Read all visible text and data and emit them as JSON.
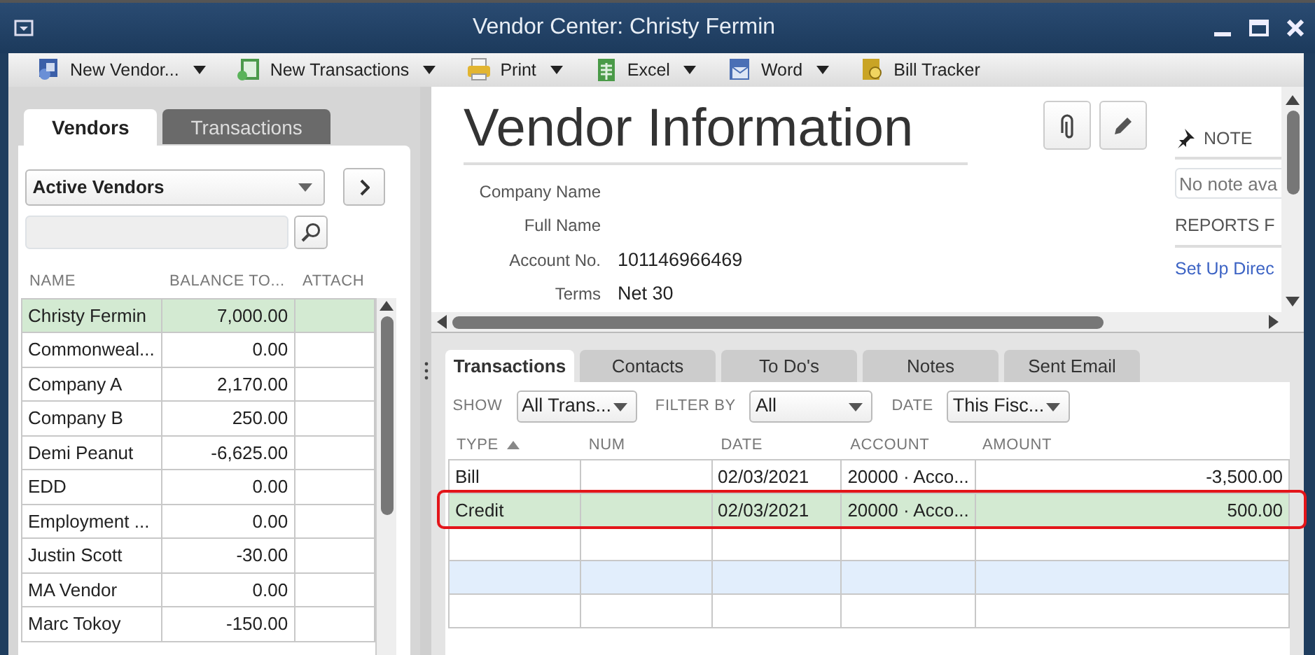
{
  "window": {
    "title": "Vendor Center: Christy Fermin"
  },
  "toolbar": [
    {
      "label": "New Vendor...",
      "dropdown": true
    },
    {
      "label": "New Transactions",
      "dropdown": true
    },
    {
      "label": "Print",
      "dropdown": true
    },
    {
      "label": "Excel",
      "dropdown": true
    },
    {
      "label": "Word",
      "dropdown": true
    },
    {
      "label": "Bill Tracker",
      "dropdown": false
    }
  ],
  "left_panel": {
    "tabs": [
      {
        "label": "Vendors",
        "selected": true
      },
      {
        "label": "Transactions",
        "selected": false
      }
    ],
    "view_filter": "Active Vendors",
    "columns": [
      "NAME",
      "BALANCE TO...",
      "ATTACH"
    ],
    "rows": [
      {
        "name": "Christy Fermin",
        "balance": "7,000.00",
        "selected": true
      },
      {
        "name": "Commonweal...",
        "balance": "0.00",
        "selected": false
      },
      {
        "name": "Company A",
        "balance": "2,170.00",
        "selected": false
      },
      {
        "name": "Company B",
        "balance": "250.00",
        "selected": false
      },
      {
        "name": "Demi Peanut",
        "balance": "-6,625.00",
        "selected": false
      },
      {
        "name": "EDD",
        "balance": "0.00",
        "selected": false
      },
      {
        "name": "Employment ...",
        "balance": "0.00",
        "selected": false
      },
      {
        "name": "Justin Scott",
        "balance": "-30.00",
        "selected": false
      },
      {
        "name": "MA Vendor",
        "balance": "0.00",
        "selected": false
      },
      {
        "name": "Marc Tokoy",
        "balance": "-150.00",
        "selected": false
      }
    ]
  },
  "vendor_info": {
    "title": "Vendor Information",
    "fields": [
      {
        "label": "Company Name"
      },
      {
        "label": "Full Name"
      },
      {
        "label": "Account No.",
        "value": "101146966469"
      },
      {
        "label": "Terms",
        "value": "Net 30"
      }
    ],
    "note_heading": "NOTE",
    "note_placeholder": "No note ava",
    "reports_heading": "REPORTS F",
    "reports_link": "Set Up Direc"
  },
  "transactions": {
    "tabs": [
      {
        "label": "Transactions",
        "selected": true
      },
      {
        "label": "Contacts",
        "selected": false
      },
      {
        "label": "To Do's",
        "selected": false
      },
      {
        "label": "Notes",
        "selected": false
      },
      {
        "label": "Sent Email",
        "selected": false
      }
    ],
    "filters": [
      {
        "label": "SHOW",
        "value": "All Trans..."
      },
      {
        "label": "FILTER BY",
        "value": "All"
      },
      {
        "label": "DATE",
        "value": "This Fisc..."
      }
    ],
    "columns": [
      {
        "label": "TYPE",
        "sorted": true
      },
      {
        "label": "NUM",
        "sorted": false
      },
      {
        "label": "DATE",
        "sorted": false
      },
      {
        "label": "ACCOUNT",
        "sorted": false
      },
      {
        "label": "AMOUNT",
        "sorted": false
      }
    ],
    "rows": [
      {
        "cells": [
          "Bill",
          "",
          "02/03/2021",
          "20000 · Acco...",
          "-3,500.00"
        ],
        "selected": false,
        "highlighted": false
      },
      {
        "cells": [
          "Credit",
          "",
          "02/03/2021",
          "20000 · Acco...",
          "500.00"
        ],
        "selected": true,
        "highlighted": true
      }
    ]
  }
}
